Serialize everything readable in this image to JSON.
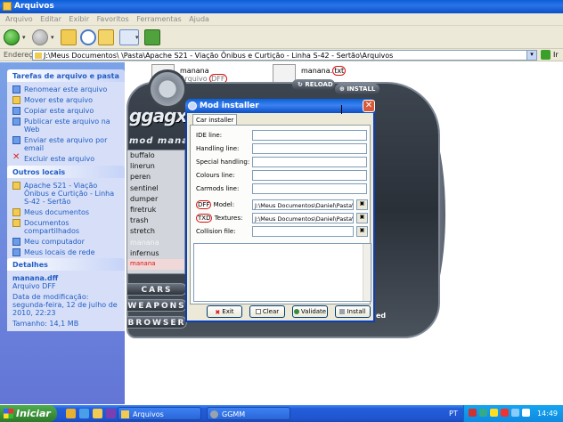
{
  "explorer": {
    "title": "Arquivos",
    "menu": [
      "Arquivo",
      "Editar",
      "Exibir",
      "Favoritos",
      "Ferramentas",
      "Ajuda"
    ],
    "address_label": "Endereço",
    "address": "J:\\Meus Documentos\\                           \\Pasta\\Apache S21 - Viação Ônibus e Curtição - Linha S-42 - Sertão\\Arquivos",
    "go_label": "Ir"
  },
  "taskpane": {
    "file_tasks": {
      "title": "Tarefas de arquivo e pasta",
      "items": [
        "Renomear este arquivo",
        "Mover este arquivo",
        "Copiar este arquivo",
        "Publicar este arquivo na Web",
        "Enviar este arquivo por email",
        "Excluir este arquivo"
      ]
    },
    "other_places": {
      "title": "Outros locais",
      "items": [
        "Apache S21 - Viação Ônibus e Curtição - Linha S-42 - Sertão",
        "Meus documentos",
        "Documentos compartilhados",
        "Meu computador",
        "Meus locais de rede"
      ]
    },
    "details": {
      "title": "Detalhes",
      "name": "manana.dff",
      "type": "Arquivo DFF",
      "modified": "Data de modificação: segunda-feira, 12 de julho de 2010, 22:23",
      "size": "Tamanho: 14,1 MB"
    }
  },
  "files": [
    {
      "name": "manana",
      "type_prefix": "Arquivo ",
      "type_ext": "DFF"
    },
    {
      "name": "manana.",
      "type_prefix": "",
      "type_ext": "txt"
    }
  ],
  "ggmm": {
    "logo": "ggagxagxg",
    "subtitle": "mod manager",
    "reload": "RELOAD",
    "install": "INSTALL",
    "vehicles": [
      "buffalo",
      "linerun",
      "peren",
      "sentinel",
      "dumper",
      "firetruk",
      "trash",
      "stretch",
      "manana",
      "infernus",
      "manana"
    ],
    "buttons": [
      "CARS",
      "WEAPONS",
      "BROWSER"
    ],
    "corner": "ed"
  },
  "dialog": {
    "title": "Mod installer",
    "tab": "Car installer",
    "fields": [
      {
        "label": "IDE line:",
        "value": ""
      },
      {
        "label": "Handling line:",
        "value": ""
      },
      {
        "label": "Special handling:",
        "value": ""
      },
      {
        "label": "Colours line:",
        "value": ""
      },
      {
        "label": "Carmods line:",
        "value": ""
      }
    ],
    "file_fields": [
      {
        "label_ring": "DFF",
        "label_rest": " Model:",
        "value": "J:\\Meus Documentos\\Daniel\\Pasta\\Apa"
      },
      {
        "label_ring": "TXD",
        "label_rest": " Textures:",
        "value": "J:\\Meus Documentos\\Daniel\\Pasta\\Apa"
      },
      {
        "label_ring": "",
        "label_rest": "Collision file:",
        "value": ""
      }
    ],
    "buttons": {
      "exit": "Exit",
      "clear": "Clear",
      "validate": "Validate",
      "install": "Install"
    }
  },
  "taskbar": {
    "start": "Iniciar",
    "items": [
      "Arquivos",
      "GGMM"
    ],
    "language": "PT",
    "clock": "14:49"
  }
}
